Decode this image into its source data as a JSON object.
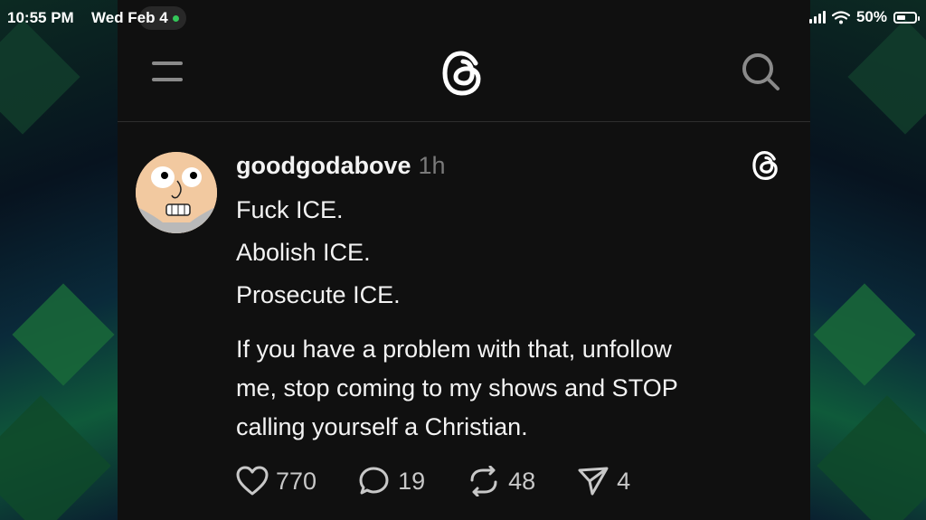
{
  "status_bar": {
    "time": "10:55 PM",
    "date": "Wed Feb 4",
    "battery": "50%",
    "battery_level": 0.5,
    "icons": [
      "signal-icon",
      "wifi-icon",
      "battery-icon"
    ]
  },
  "header": {
    "menu_icon": "menu-icon",
    "logo_icon": "threads-logo-icon",
    "search_icon": "search-icon"
  },
  "post": {
    "username": "goodgodabove",
    "time": "1h",
    "lines": [
      "Fuck ICE.",
      "Abolish ICE.",
      "Prosecute ICE."
    ],
    "paragraph_lines": [
      "If you have a problem with that, unfollow",
      "me, stop coming to my shows and STOP",
      "calling yourself a Christian."
    ],
    "actions": {
      "likes": "770",
      "replies": "19",
      "reposts": "48",
      "shares": "4"
    }
  },
  "colors": {
    "app_background": "#101010",
    "text": "#f3f3f3",
    "muted": "#7a7a7a"
  }
}
